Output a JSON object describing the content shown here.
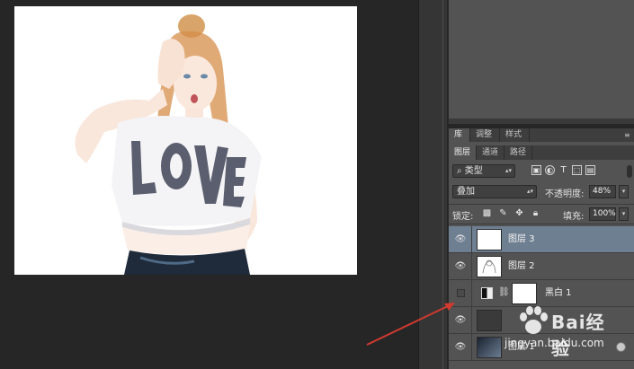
{
  "panel": {
    "tabs_top": [
      "库",
      "调整",
      "样式"
    ],
    "tabs_layers": [
      "图层",
      "通道",
      "路径"
    ],
    "filter": {
      "kind": "类型",
      "icons": [
        "image-filter-icon",
        "adjustment-filter-icon",
        "type-filter-icon",
        "shape-filter-icon",
        "smart-object-filter-icon"
      ],
      "type_glyph": "T"
    },
    "blend": {
      "mode": "叠加",
      "opacity_label": "不透明度:",
      "opacity_value": "48%"
    },
    "lock": {
      "label": "锁定:",
      "fill_label": "填充:",
      "fill_value": "100%"
    },
    "layers": [
      {
        "name": "图层 3",
        "visible": true,
        "selected": true
      },
      {
        "name": "图层 2",
        "visible": true,
        "selected": false
      },
      {
        "name": "黑白 1",
        "visible": false,
        "selected": false
      },
      {
        "name": "",
        "visible": true,
        "selected": false
      },
      {
        "name": "图层 1",
        "visible": true,
        "selected": false
      }
    ]
  },
  "canvas": {
    "shirt_text": "LOVE"
  },
  "watermark": {
    "main": "Bai经验",
    "sub": "jingyan.baidu.com"
  },
  "colors": {
    "selected_layer": "#6f7f92",
    "annotation_arrow": "#d03a2f"
  }
}
